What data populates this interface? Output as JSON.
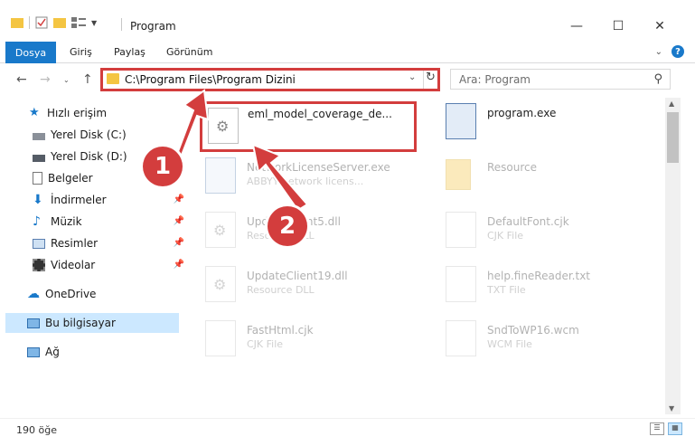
{
  "window": {
    "title": "Program"
  },
  "ribbon": {
    "tabs": [
      "Dosya",
      "Giriş",
      "Paylaş",
      "Görünüm"
    ]
  },
  "address": {
    "path": "C:\\Program Files\\Program Dizini"
  },
  "search": {
    "placeholder": "Ara: Program"
  },
  "nav": {
    "items": [
      {
        "label": "Hızlı erişim",
        "icon": "star-icon"
      },
      {
        "label": "Yerel Disk (C:)",
        "icon": "drive-icon"
      },
      {
        "label": "Yerel Disk (D:)",
        "icon": "drive-icon"
      },
      {
        "label": "Belgeler",
        "icon": "documents-icon"
      },
      {
        "label": "İndirmeler",
        "icon": "download-icon"
      },
      {
        "label": "Müzik",
        "icon": "music-icon"
      },
      {
        "label": "Resimler",
        "icon": "pictures-icon"
      },
      {
        "label": "Videolar",
        "icon": "video-icon"
      },
      {
        "label": "OneDrive",
        "icon": "cloud-icon"
      },
      {
        "label": "Bu bilgisayar",
        "icon": "computer-icon"
      },
      {
        "label": "Ağ",
        "icon": "network-icon"
      }
    ]
  },
  "files": [
    {
      "name": "eml_model_coverage_de...",
      "type": ""
    },
    {
      "name": "program.exe",
      "type": ""
    },
    {
      "name": "NetworkLicenseServer.exe",
      "type": "ABBYY network licens..."
    },
    {
      "name": "Resource",
      "type": ""
    },
    {
      "name": "UpdateClient5.dll",
      "type": "Resource DLL"
    },
    {
      "name": "DefaultFont.cjk",
      "type": "CJK File"
    },
    {
      "name": "UpdateClient19.dll",
      "type": "Resource DLL"
    },
    {
      "name": "help.fineReader.txt",
      "type": "TXT File"
    },
    {
      "name": "FastHtml.cjk",
      "type": "CJK File"
    },
    {
      "name": "SndToWP16.wcm",
      "type": "WCM File"
    }
  ],
  "status": {
    "count": "190 öğe"
  },
  "callouts": [
    "1",
    "2"
  ],
  "colors": {
    "accent": "#1979ca",
    "highlight": "#d33d3d",
    "selection": "#cce8ff"
  }
}
